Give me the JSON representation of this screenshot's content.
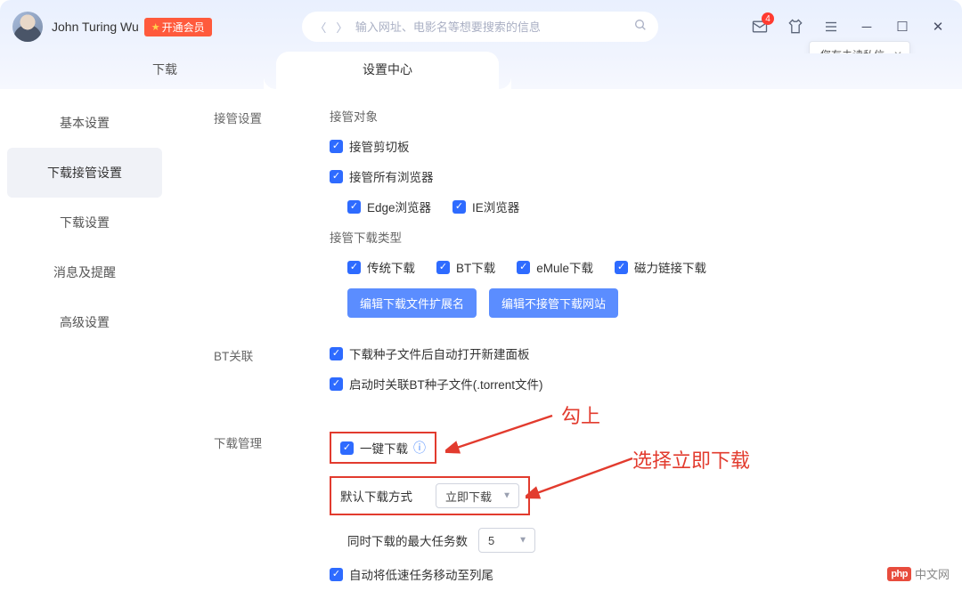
{
  "header": {
    "username": "John Turing Wu",
    "vip_label": "开通会员",
    "search_placeholder": "输入网址、电影名等想要搜索的信息",
    "msg_badge": "4",
    "notif_text": "您有未读私信"
  },
  "tabs": [
    {
      "label": "下载",
      "active": false
    },
    {
      "label": "设置中心",
      "active": true
    }
  ],
  "sidebar": [
    {
      "label": "基本设置",
      "active": false
    },
    {
      "label": "下载接管设置",
      "active": true
    },
    {
      "label": "下载设置",
      "active": false
    },
    {
      "label": "消息及提醒",
      "active": false
    },
    {
      "label": "高级设置",
      "active": false
    }
  ],
  "sections": {
    "takeover": {
      "title": "接管设置",
      "target_label": "接管对象",
      "cb_clipboard": "接管剪切板",
      "cb_all_browsers": "接管所有浏览器",
      "cb_edge": "Edge浏览器",
      "cb_ie": "IE浏览器",
      "type_label": "接管下载类型",
      "cb_traditional": "传统下载",
      "cb_bt": "BT下载",
      "cb_emule": "eMule下载",
      "cb_magnet": "磁力链接下载",
      "btn_edit_ext": "编辑下载文件扩展名",
      "btn_edit_block": "编辑不接管下载网站"
    },
    "bt": {
      "title": "BT关联",
      "cb_open_panel": "下载种子文件后自动打开新建面板",
      "cb_assoc_torrent": "启动时关联BT种子文件(.torrent文件)"
    },
    "dlmgr": {
      "title": "下载管理",
      "cb_oneclick": "一键下载",
      "default_mode_label": "默认下载方式",
      "default_mode_value": "立即下载",
      "max_tasks_label": "同时下载的最大任务数",
      "max_tasks_value": "5",
      "cb_move_slow": "自动将低速任务移动至列尾"
    }
  },
  "annotations": {
    "check_it": "勾上",
    "select_now": "选择立即下载"
  },
  "watermark": "中文网"
}
